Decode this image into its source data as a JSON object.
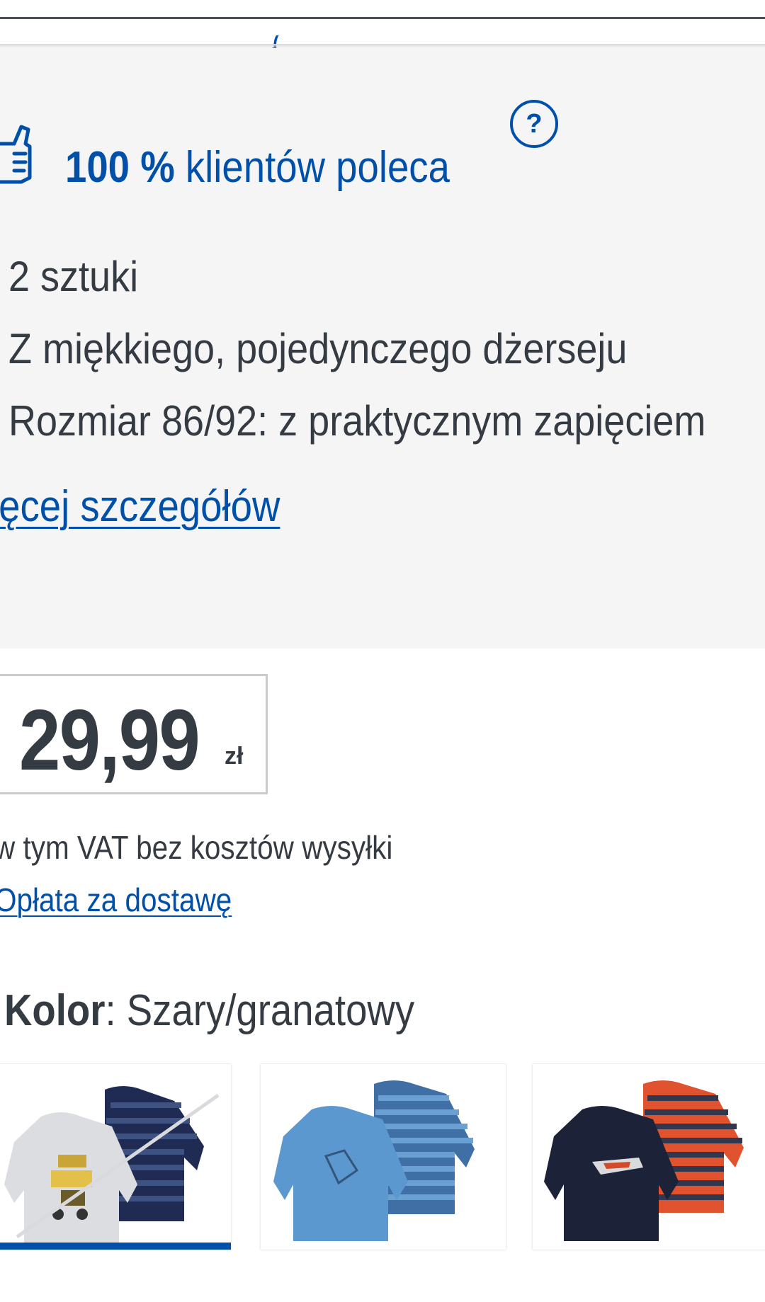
{
  "header": {
    "rating_clipped": "( )"
  },
  "recommendation": {
    "percent": "100 %",
    "text": "klientów poleca",
    "help_glyph": "?"
  },
  "features": [
    "2 sztuki",
    "Z miękkiego, pojedynczego dżerseju",
    "Rozmiar 86/92: z praktycznym zapięciem"
  ],
  "more_details_link": "ięcej szczegółów",
  "price": {
    "value": "29,99",
    "currency": "zł",
    "vat_note": "w tym VAT bez kosztów wysyłki",
    "delivery_link": "Opłata za dostawę"
  },
  "color": {
    "label": "Kolor",
    "separator": ": ",
    "value": "Szary/granatowy",
    "swatches": [
      {
        "name": "grey-navy",
        "selected": true,
        "unavailable": true,
        "colors": [
          "#d9dadc",
          "#1f2b52"
        ]
      },
      {
        "name": "blue-striped",
        "selected": false,
        "unavailable": false,
        "colors": [
          "#5a98cf",
          "#3f6fa4"
        ]
      },
      {
        "name": "navy-orange",
        "selected": false,
        "unavailable": false,
        "colors": [
          "#1c2238",
          "#e0532e"
        ]
      }
    ]
  },
  "colors": {
    "brand_blue": "#0050aa",
    "text": "#353b42",
    "panel_bg": "#f5f5f6"
  }
}
